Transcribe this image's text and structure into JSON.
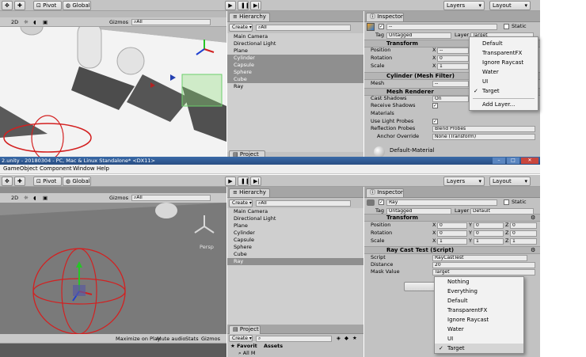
{
  "top": {
    "toolbar": {
      "pivot_label": "Pivot",
      "global_label": "Global",
      "layers_label": "Layers",
      "layout_label": "Layout"
    },
    "scene": {
      "mode_label": "2D",
      "gizmos_label": "Gizmos",
      "search_placeholder": "All"
    },
    "hierarchy": {
      "tab_label": "Hierarchy",
      "create_label": "Create",
      "search_placeholder": "All",
      "items": [
        "Main Camera",
        "Directional Light",
        "Plane",
        "Cylinder",
        "Capsule",
        "Sphere",
        "Cube",
        "Ray"
      ],
      "project_tab_label": "Project"
    },
    "inspector": {
      "tab_label": "Inspector",
      "name_value": "--",
      "static_label": "Static",
      "tag_label": "Tag",
      "tag_value": "Untagged",
      "layer_label": "Layer",
      "layer_value": "Target",
      "transform_title": "Transform",
      "position_label": "Position",
      "position_x": "--",
      "rotation_label": "Rotation",
      "rotation_x": "0",
      "scale_label": "Scale",
      "scale_x": "1",
      "mesh_filter_title": "Cylinder (Mesh Filter)",
      "mesh_label": "Mesh",
      "mesh_value": "--",
      "mesh_renderer_title": "Mesh Renderer",
      "cast_shadows_label": "Cast Shadows",
      "cast_shadows_value": "On",
      "receive_shadows_label": "Receive Shadows",
      "materials_label": "Materials",
      "use_light_probes_label": "Use Light Probes",
      "reflection_probes_label": "Reflection Probes",
      "reflection_probes_value": "Blend Probes",
      "anchor_override_label": "Anchor Override",
      "anchor_override_value": "None (Transform)",
      "material_name": "Default-Material"
    },
    "layer_menu": {
      "items": [
        "Default",
        "TransparentFX",
        "Ignore Raycast",
        "Water",
        "UI",
        "Target"
      ],
      "checked_item": "Target",
      "add_layer_label": "Add Layer..."
    }
  },
  "titlebar": {
    "text": "2.unity - 20180304 - PC, Mac & Linux Standalone* <DX11>"
  },
  "menubar": {
    "items": [
      "GameObject",
      "Component",
      "Window",
      "Help"
    ]
  },
  "bottom": {
    "toolbar": {
      "pivot_label": "Pivot",
      "global_label": "Global",
      "layers_label": "Layers",
      "layout_label": "Layout"
    },
    "scene": {
      "mode_label": "2D",
      "gizmos_label": "Gizmos",
      "search_placeholder": "All",
      "persp_label": "Persp"
    },
    "game": {
      "maximize_label": "Maximize on Play",
      "mute_label": "Mute audio",
      "stats_label": "Stats",
      "gizmos_label": "Gizmos"
    },
    "hierarchy": {
      "tab_label": "Hierarchy",
      "create_label": "Create",
      "search_placeholder": "All",
      "items": [
        "Main Camera",
        "Directional Light",
        "Plane",
        "Cylinder",
        "Capsule",
        "Sphere",
        "Cube",
        "Ray"
      ],
      "selected_item": "Ray"
    },
    "project": {
      "tab_label": "Project",
      "create_label": "Create",
      "favorites_label": "Favorit",
      "assets_label": "Assets",
      "all_label": "All M"
    },
    "inspector": {
      "tab_label": "Inspector",
      "name_value": "Ray",
      "static_label": "Static",
      "tag_label": "Tag",
      "tag_value": "Untagged",
      "layer_label": "Layer",
      "layer_value": "Default",
      "transform_title": "Transform",
      "position_label": "Position",
      "rotation_label": "Rotation",
      "scale_label": "Scale",
      "axis_x": "X",
      "axis_y": "Y",
      "axis_z": "Z",
      "position": [
        "0",
        "0",
        "0"
      ],
      "rotation": [
        "0",
        "0",
        "0"
      ],
      "scale": [
        "1",
        "1",
        "1"
      ],
      "script_component_title": "Ray Cast Test (Script)",
      "script_label": "Script",
      "script_value": "RayCastTest",
      "distance_label": "Distance",
      "distance_value": "20",
      "mask_label": "Mask Value",
      "mask_value": "Target"
    },
    "mask_menu": {
      "items": [
        "Nothing",
        "Everything",
        "Default",
        "TransparentFX",
        "Ignore Raycast",
        "Water",
        "UI",
        "Target"
      ],
      "checked_item": "Target"
    }
  }
}
